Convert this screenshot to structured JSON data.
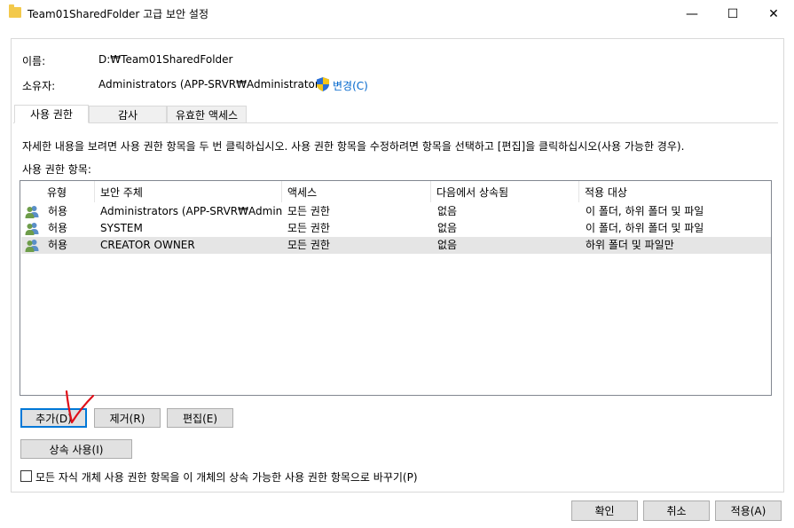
{
  "window": {
    "title": "Team01SharedFolder 고급 보안 설정",
    "minimize_glyph": "—",
    "maximize_glyph": "☐",
    "close_glyph": "✕"
  },
  "fields": {
    "name_label": "이름:",
    "name_value": "D:₩Team01SharedFolder",
    "owner_label": "소유자:",
    "owner_value": "Administrators (APP-SRVR₩Administrators)",
    "change_link": "변경(C)"
  },
  "tabs": [
    {
      "label": "사용 권한",
      "active": true
    },
    {
      "label": "감사",
      "active": false
    },
    {
      "label": "유효한 액세스",
      "active": false
    }
  ],
  "description": "자세한 내용을 보려면 사용 권한 항목을 두 번 클릭하십시오. 사용 권한 항목을 수정하려면 항목을 선택하고 [편집]을 클릭하십시오(사용 가능한 경우).",
  "entries_label": "사용 권한 항목:",
  "table": {
    "columns": [
      "유형",
      "보안 주체",
      "액세스",
      "다음에서 상속됨",
      "적용 대상"
    ],
    "rows": [
      {
        "type": "허용",
        "principal": "Administrators (APP-SRVR₩Admini...",
        "access": "모든 권한",
        "inherited": "없음",
        "applies": "이 폴더, 하위 폴더 및 파일",
        "icon": "users-icon"
      },
      {
        "type": "허용",
        "principal": "SYSTEM",
        "access": "모든 권한",
        "inherited": "없음",
        "applies": "이 폴더, 하위 폴더 및 파일",
        "icon": "users-icon"
      },
      {
        "type": "허용",
        "principal": "CREATOR OWNER",
        "access": "모든 권한",
        "inherited": "없음",
        "applies": "하위 폴더 및 파일만",
        "icon": "users-icon",
        "selected": true
      }
    ]
  },
  "buttons": {
    "add": "추가(D)",
    "remove": "제거(R)",
    "edit": "편집(E)",
    "inheritance": "상속 사용(I)",
    "ok": "확인",
    "cancel": "취소",
    "apply": "적용(A)"
  },
  "replace_checkbox": {
    "label": "모든 자식 개체 사용 권한 항목을 이 개체의 상속 가능한 사용 권한 항목으로 바꾸기(P)",
    "checked": false
  },
  "colors": {
    "accent": "#0078d7",
    "link": "#0066cc",
    "annotation": "#e0101a"
  }
}
